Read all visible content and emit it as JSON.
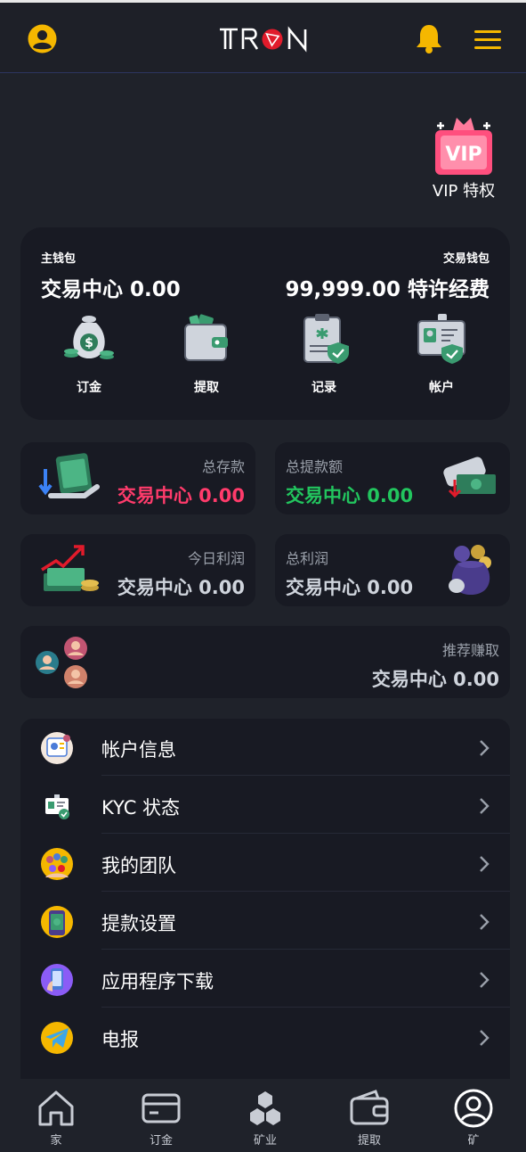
{
  "header": {
    "logo_text": "TRON",
    "icons": [
      "user-icon",
      "bell-icon",
      "menu-icon"
    ],
    "accent": "#f5b700"
  },
  "vip": {
    "badge_text": "VIP",
    "label": "VIP 特权"
  },
  "wallet": {
    "main_label": "主钱包",
    "main_value": "交易中心 0.00",
    "trade_label": "交易钱包",
    "trade_value": "99,999.00 特许经费",
    "actions": [
      {
        "label": "订金",
        "icon": "money-bag-icon"
      },
      {
        "label": "提取",
        "icon": "wallet-icon"
      },
      {
        "label": "记录",
        "icon": "clipboard-icon"
      },
      {
        "label": "帐户",
        "icon": "id-card-icon"
      }
    ]
  },
  "stats": {
    "total_deposit": {
      "title": "总存款",
      "value": "交易中心 0.00",
      "color": "#ff3b6b"
    },
    "total_withdraw": {
      "title": "总提款额",
      "value": "交易中心 0.00",
      "color": "#22c55e"
    },
    "today_profit": {
      "title": "今日利润",
      "value": "交易中心 0.00"
    },
    "total_profit": {
      "title": "总利润",
      "value": "交易中心 0.00"
    },
    "referral": {
      "title": "推荐赚取",
      "value": "交易中心 0.00"
    }
  },
  "menu": [
    {
      "label": "帐户信息",
      "icon": "account-info-icon"
    },
    {
      "label": "KYC 状态",
      "icon": "kyc-icon"
    },
    {
      "label": "我的团队",
      "icon": "team-icon"
    },
    {
      "label": "提款设置",
      "icon": "withdraw-settings-icon"
    },
    {
      "label": "应用程序下载",
      "icon": "app-download-icon"
    },
    {
      "label": "电报",
      "icon": "telegram-icon"
    }
  ],
  "tabbar": [
    {
      "label": "家",
      "icon": "home-icon"
    },
    {
      "label": "订金",
      "icon": "card-icon"
    },
    {
      "label": "矿业",
      "icon": "mining-icon"
    },
    {
      "label": "提取",
      "icon": "wallet-icon"
    },
    {
      "label": "矿",
      "icon": "profile-icon"
    }
  ]
}
